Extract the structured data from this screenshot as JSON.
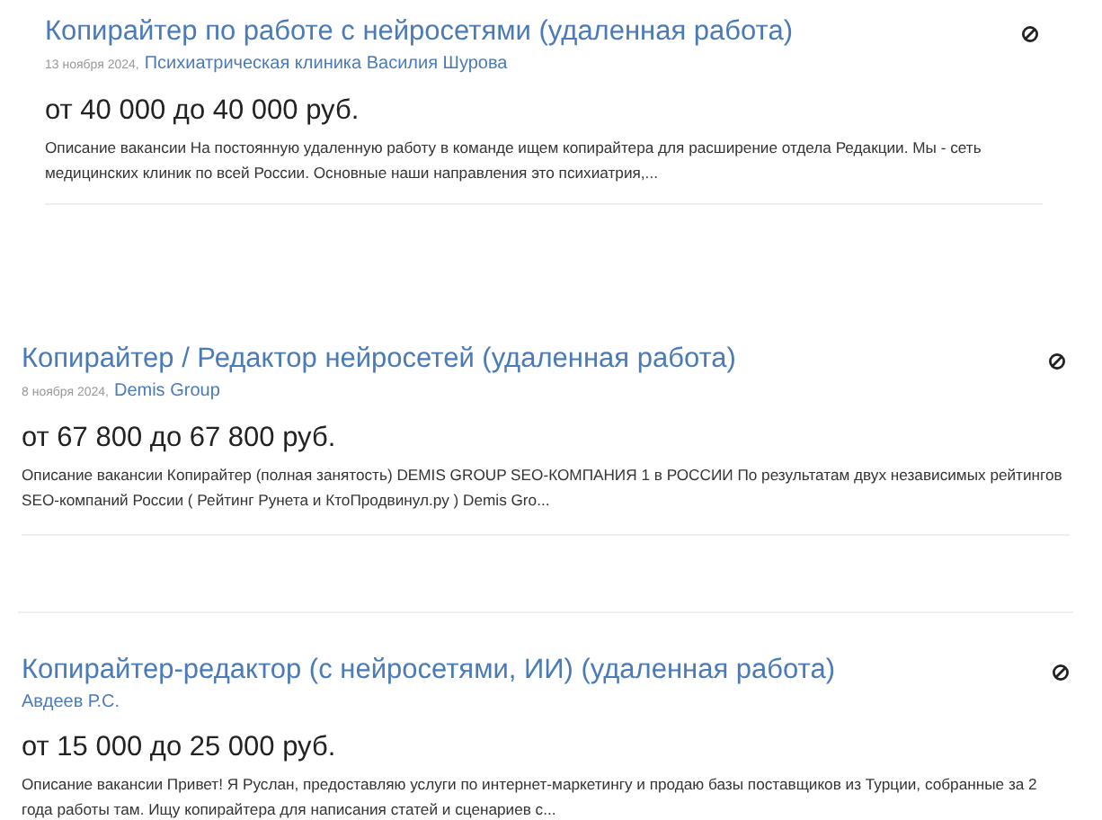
{
  "vacancies": [
    {
      "title": "Копирайтер по работе с нейросетями (удаленная работа)",
      "date": "13 ноября 2024,",
      "company": "Психиатрическая клиника Василия Шурова",
      "salary": "от 40 000 до 40 000 руб.",
      "description": "Описание вакансии На постоянную удаленную работу в команде ищем копирайтера для расширение отдела Редакции. Мы - сеть медицинских клиник по всей России. Основные наши направления это психиатрия,..."
    },
    {
      "title": "Копирайтер / Редактор нейросетей (удаленная работа)",
      "date": "8 ноября 2024,",
      "company": "Demis Group",
      "salary": "от 67 800 до 67 800 руб.",
      "description": "Описание вакансии Копирайтер (полная занятость) DEMIS GROUP SEO-КОМПАНИЯ 1 в РОССИИ По результатам двух независимых рейтингов SEO-компаний России ( Рейтинг Рунета и КтоПродвинул.ру ) Demis Gro..."
    },
    {
      "title": "Копирайтер-редактор (с нейросетями, ИИ) (удаленная работа)",
      "company": "Авдеев Р.С.",
      "salary": "от 15 000 до 25 000 руб.",
      "description": "Описание вакансии Привет! Я Руслан, предоставляю услуги по интернет-маркетингу и продаю базы поставщиков из Турции, собранные за 2 года работы там. Ищу копирайтера для написания статей и сценариев с..."
    }
  ]
}
